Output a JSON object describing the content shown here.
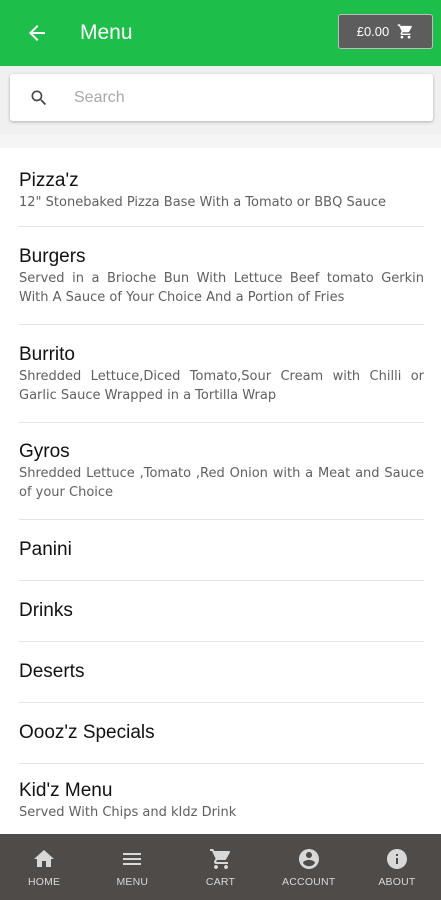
{
  "appbar": {
    "title": "Menu",
    "cart_total": "£0.00",
    "icons": {
      "back": "arrow-back-icon",
      "cart": "cart-icon"
    },
    "color": "#1ebe4a"
  },
  "search": {
    "placeholder": "Search",
    "value": "",
    "icon": "search-icon"
  },
  "menu": {
    "items": [
      {
        "title": "Pizza'z",
        "description": "12\" Stonebaked Pizza Base With a Tomato or BBQ Sauce"
      },
      {
        "title": "Burgers",
        "description": "Served in a Brioche Bun With Lettuce Beef tomato Gerkin With A Sauce of Your Choice And a Portion of Fries"
      },
      {
        "title": "Burrito",
        "description": "Shredded Lettuce,Diced Tomato,Sour Cream with Chilli or Garlic Sauce Wrapped in a Tortilla Wrap"
      },
      {
        "title": "Gyros",
        "description": "Shredded Lettuce ,Tomato ,Red Onion with a Meat and Sauce of your Choice"
      },
      {
        "title": "Panini"
      },
      {
        "title": "Drinks"
      },
      {
        "title": "Deserts"
      },
      {
        "title": "Oooz'z Specials"
      },
      {
        "title": "Kid'z Menu",
        "description": "Served With Chips and kIdz Drink"
      }
    ]
  },
  "bottom_nav": {
    "color": "#4f4b49",
    "items": [
      {
        "label": "HOME",
        "icon": "home-icon"
      },
      {
        "label": "MENU",
        "icon": "menu-icon"
      },
      {
        "label": "CART",
        "icon": "cart-icon"
      },
      {
        "label": "ACCOUNT",
        "icon": "account-icon"
      },
      {
        "label": "ABOUT",
        "icon": "info-icon"
      }
    ]
  }
}
